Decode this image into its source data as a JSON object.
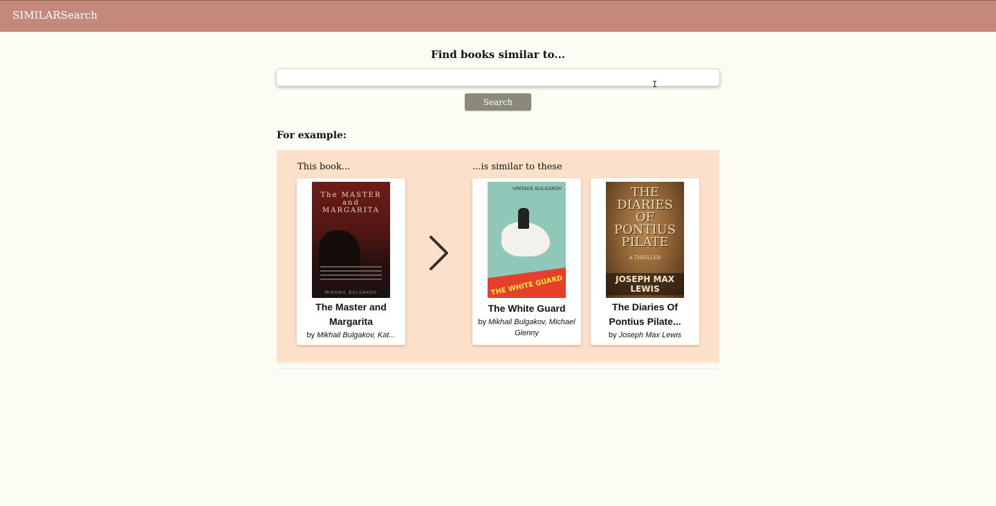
{
  "header": {
    "brand": "SIMILARSearch"
  },
  "search": {
    "heading": "Find books similar to...",
    "value": "",
    "placeholder": "",
    "button_label": "Search"
  },
  "example": {
    "label": "For example:",
    "source_label": "This book...",
    "similar_label": "...is similar to these",
    "source_book": {
      "title": "The Master and Margarita",
      "by": "by",
      "authors": "Mikhail Bulgakov, Kat...",
      "cover_text_1": "The MASTER and",
      "cover_text_2": "MARGARITA",
      "cover_author": "MIKHAIL BULGAKOV"
    },
    "similar_books": [
      {
        "title": "The White Guard",
        "by": "by",
        "authors": "Mikhail Bulgakov, Michael Glenny",
        "cover_publisher": "VINTAGE BULGAKOV",
        "cover_title": "THE WHITE GUARD"
      },
      {
        "title": "The Diaries Of Pontius Pilate...",
        "by": "by",
        "authors": "Joseph Max Lewis",
        "cover_line_1": "THE",
        "cover_line_2": "DIARIES",
        "cover_line_3": "OF",
        "cover_line_4": "PONTIUS",
        "cover_line_5": "PILATE",
        "cover_subtitle": "A THRILLER",
        "cover_author": "JOSEPH MAX LEWIS"
      }
    ],
    "arrow_icon": "chevron-right-icon"
  },
  "colors": {
    "header_bg": "#c4897a",
    "page_bg": "#fdfcf4",
    "panel_bg": "#fde0ca",
    "button_bg": "#8b8a79"
  }
}
